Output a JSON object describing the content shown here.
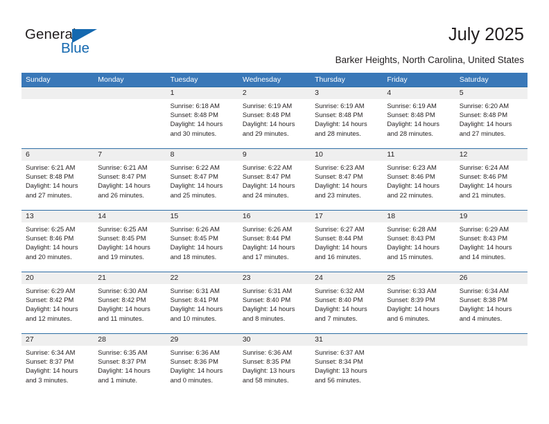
{
  "brand": {
    "name_part1": "General",
    "name_part2": "Blue",
    "accent_color": "#1569b0"
  },
  "header": {
    "title": "July 2025",
    "subtitle": "Barker Heights, North Carolina, United States"
  },
  "calendar": {
    "header_bg": "#3a78b8",
    "row_border_color": "#2e6da4",
    "daystrip_bg": "#efefef",
    "weekday_headers": [
      "Sunday",
      "Monday",
      "Tuesday",
      "Wednesday",
      "Thursday",
      "Friday",
      "Saturday"
    ],
    "weeks": [
      [
        {
          "day": "",
          "sunrise": "",
          "sunset": "",
          "daylight_l1": "",
          "daylight_l2": ""
        },
        {
          "day": "",
          "sunrise": "",
          "sunset": "",
          "daylight_l1": "",
          "daylight_l2": ""
        },
        {
          "day": "1",
          "sunrise": "Sunrise: 6:18 AM",
          "sunset": "Sunset: 8:48 PM",
          "daylight_l1": "Daylight: 14 hours",
          "daylight_l2": "and 30 minutes."
        },
        {
          "day": "2",
          "sunrise": "Sunrise: 6:19 AM",
          "sunset": "Sunset: 8:48 PM",
          "daylight_l1": "Daylight: 14 hours",
          "daylight_l2": "and 29 minutes."
        },
        {
          "day": "3",
          "sunrise": "Sunrise: 6:19 AM",
          "sunset": "Sunset: 8:48 PM",
          "daylight_l1": "Daylight: 14 hours",
          "daylight_l2": "and 28 minutes."
        },
        {
          "day": "4",
          "sunrise": "Sunrise: 6:19 AM",
          "sunset": "Sunset: 8:48 PM",
          "daylight_l1": "Daylight: 14 hours",
          "daylight_l2": "and 28 minutes."
        },
        {
          "day": "5",
          "sunrise": "Sunrise: 6:20 AM",
          "sunset": "Sunset: 8:48 PM",
          "daylight_l1": "Daylight: 14 hours",
          "daylight_l2": "and 27 minutes."
        }
      ],
      [
        {
          "day": "6",
          "sunrise": "Sunrise: 6:21 AM",
          "sunset": "Sunset: 8:48 PM",
          "daylight_l1": "Daylight: 14 hours",
          "daylight_l2": "and 27 minutes."
        },
        {
          "day": "7",
          "sunrise": "Sunrise: 6:21 AM",
          "sunset": "Sunset: 8:47 PM",
          "daylight_l1": "Daylight: 14 hours",
          "daylight_l2": "and 26 minutes."
        },
        {
          "day": "8",
          "sunrise": "Sunrise: 6:22 AM",
          "sunset": "Sunset: 8:47 PM",
          "daylight_l1": "Daylight: 14 hours",
          "daylight_l2": "and 25 minutes."
        },
        {
          "day": "9",
          "sunrise": "Sunrise: 6:22 AM",
          "sunset": "Sunset: 8:47 PM",
          "daylight_l1": "Daylight: 14 hours",
          "daylight_l2": "and 24 minutes."
        },
        {
          "day": "10",
          "sunrise": "Sunrise: 6:23 AM",
          "sunset": "Sunset: 8:47 PM",
          "daylight_l1": "Daylight: 14 hours",
          "daylight_l2": "and 23 minutes."
        },
        {
          "day": "11",
          "sunrise": "Sunrise: 6:23 AM",
          "sunset": "Sunset: 8:46 PM",
          "daylight_l1": "Daylight: 14 hours",
          "daylight_l2": "and 22 minutes."
        },
        {
          "day": "12",
          "sunrise": "Sunrise: 6:24 AM",
          "sunset": "Sunset: 8:46 PM",
          "daylight_l1": "Daylight: 14 hours",
          "daylight_l2": "and 21 minutes."
        }
      ],
      [
        {
          "day": "13",
          "sunrise": "Sunrise: 6:25 AM",
          "sunset": "Sunset: 8:46 PM",
          "daylight_l1": "Daylight: 14 hours",
          "daylight_l2": "and 20 minutes."
        },
        {
          "day": "14",
          "sunrise": "Sunrise: 6:25 AM",
          "sunset": "Sunset: 8:45 PM",
          "daylight_l1": "Daylight: 14 hours",
          "daylight_l2": "and 19 minutes."
        },
        {
          "day": "15",
          "sunrise": "Sunrise: 6:26 AM",
          "sunset": "Sunset: 8:45 PM",
          "daylight_l1": "Daylight: 14 hours",
          "daylight_l2": "and 18 minutes."
        },
        {
          "day": "16",
          "sunrise": "Sunrise: 6:26 AM",
          "sunset": "Sunset: 8:44 PM",
          "daylight_l1": "Daylight: 14 hours",
          "daylight_l2": "and 17 minutes."
        },
        {
          "day": "17",
          "sunrise": "Sunrise: 6:27 AM",
          "sunset": "Sunset: 8:44 PM",
          "daylight_l1": "Daylight: 14 hours",
          "daylight_l2": "and 16 minutes."
        },
        {
          "day": "18",
          "sunrise": "Sunrise: 6:28 AM",
          "sunset": "Sunset: 8:43 PM",
          "daylight_l1": "Daylight: 14 hours",
          "daylight_l2": "and 15 minutes."
        },
        {
          "day": "19",
          "sunrise": "Sunrise: 6:29 AM",
          "sunset": "Sunset: 8:43 PM",
          "daylight_l1": "Daylight: 14 hours",
          "daylight_l2": "and 14 minutes."
        }
      ],
      [
        {
          "day": "20",
          "sunrise": "Sunrise: 6:29 AM",
          "sunset": "Sunset: 8:42 PM",
          "daylight_l1": "Daylight: 14 hours",
          "daylight_l2": "and 12 minutes."
        },
        {
          "day": "21",
          "sunrise": "Sunrise: 6:30 AM",
          "sunset": "Sunset: 8:42 PM",
          "daylight_l1": "Daylight: 14 hours",
          "daylight_l2": "and 11 minutes."
        },
        {
          "day": "22",
          "sunrise": "Sunrise: 6:31 AM",
          "sunset": "Sunset: 8:41 PM",
          "daylight_l1": "Daylight: 14 hours",
          "daylight_l2": "and 10 minutes."
        },
        {
          "day": "23",
          "sunrise": "Sunrise: 6:31 AM",
          "sunset": "Sunset: 8:40 PM",
          "daylight_l1": "Daylight: 14 hours",
          "daylight_l2": "and 8 minutes."
        },
        {
          "day": "24",
          "sunrise": "Sunrise: 6:32 AM",
          "sunset": "Sunset: 8:40 PM",
          "daylight_l1": "Daylight: 14 hours",
          "daylight_l2": "and 7 minutes."
        },
        {
          "day": "25",
          "sunrise": "Sunrise: 6:33 AM",
          "sunset": "Sunset: 8:39 PM",
          "daylight_l1": "Daylight: 14 hours",
          "daylight_l2": "and 6 minutes."
        },
        {
          "day": "26",
          "sunrise": "Sunrise: 6:34 AM",
          "sunset": "Sunset: 8:38 PM",
          "daylight_l1": "Daylight: 14 hours",
          "daylight_l2": "and 4 minutes."
        }
      ],
      [
        {
          "day": "27",
          "sunrise": "Sunrise: 6:34 AM",
          "sunset": "Sunset: 8:37 PM",
          "daylight_l1": "Daylight: 14 hours",
          "daylight_l2": "and 3 minutes."
        },
        {
          "day": "28",
          "sunrise": "Sunrise: 6:35 AM",
          "sunset": "Sunset: 8:37 PM",
          "daylight_l1": "Daylight: 14 hours",
          "daylight_l2": "and 1 minute."
        },
        {
          "day": "29",
          "sunrise": "Sunrise: 6:36 AM",
          "sunset": "Sunset: 8:36 PM",
          "daylight_l1": "Daylight: 14 hours",
          "daylight_l2": "and 0 minutes."
        },
        {
          "day": "30",
          "sunrise": "Sunrise: 6:36 AM",
          "sunset": "Sunset: 8:35 PM",
          "daylight_l1": "Daylight: 13 hours",
          "daylight_l2": "and 58 minutes."
        },
        {
          "day": "31",
          "sunrise": "Sunrise: 6:37 AM",
          "sunset": "Sunset: 8:34 PM",
          "daylight_l1": "Daylight: 13 hours",
          "daylight_l2": "and 56 minutes."
        },
        {
          "day": "",
          "sunrise": "",
          "sunset": "",
          "daylight_l1": "",
          "daylight_l2": ""
        },
        {
          "day": "",
          "sunrise": "",
          "sunset": "",
          "daylight_l1": "",
          "daylight_l2": ""
        }
      ]
    ]
  }
}
